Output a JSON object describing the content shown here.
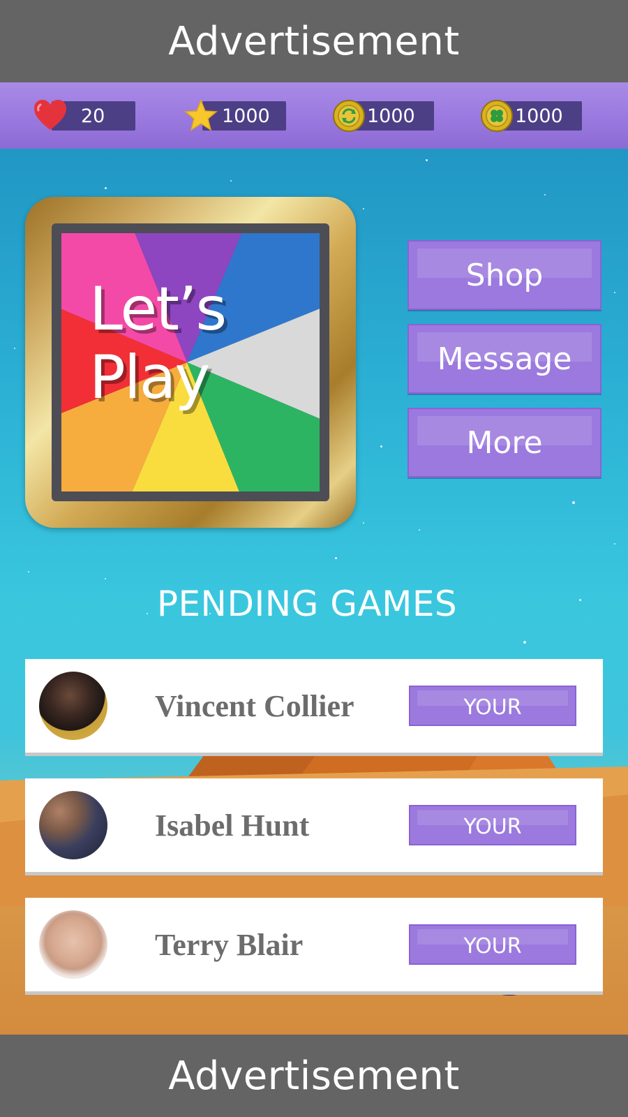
{
  "ads": {
    "top": "Advertisement",
    "bottom": "Advertisement"
  },
  "stats": [
    {
      "icon": "heart-icon",
      "value": "20"
    },
    {
      "icon": "star-icon",
      "value": "1000"
    },
    {
      "icon": "refresh-coin-icon",
      "value": "1000"
    },
    {
      "icon": "clover-coin-icon",
      "value": "1000"
    }
  ],
  "board": {
    "title_line1": "Let’s",
    "title_line2": "Play"
  },
  "menu": {
    "shop": "Shop",
    "message": "Message",
    "more": "More"
  },
  "pending": {
    "title": "PENDING GAMES",
    "games": [
      {
        "name": "Vincent Collier",
        "action": "YOUR"
      },
      {
        "name": "Isabel Hunt",
        "action": "YOUR"
      },
      {
        "name": "Terry Blair",
        "action": "YOUR"
      }
    ]
  },
  "colors": {
    "accent_purple": "#9b79de",
    "statusbar_purple": "#9a79df",
    "ad_gray": "#646464",
    "wheel": [
      "#8e45c0",
      "#2f77cd",
      "#d9d9d9",
      "#2db462",
      "#f9dd3f",
      "#f6ad3e",
      "#f22f36",
      "#f34aa7"
    ]
  }
}
